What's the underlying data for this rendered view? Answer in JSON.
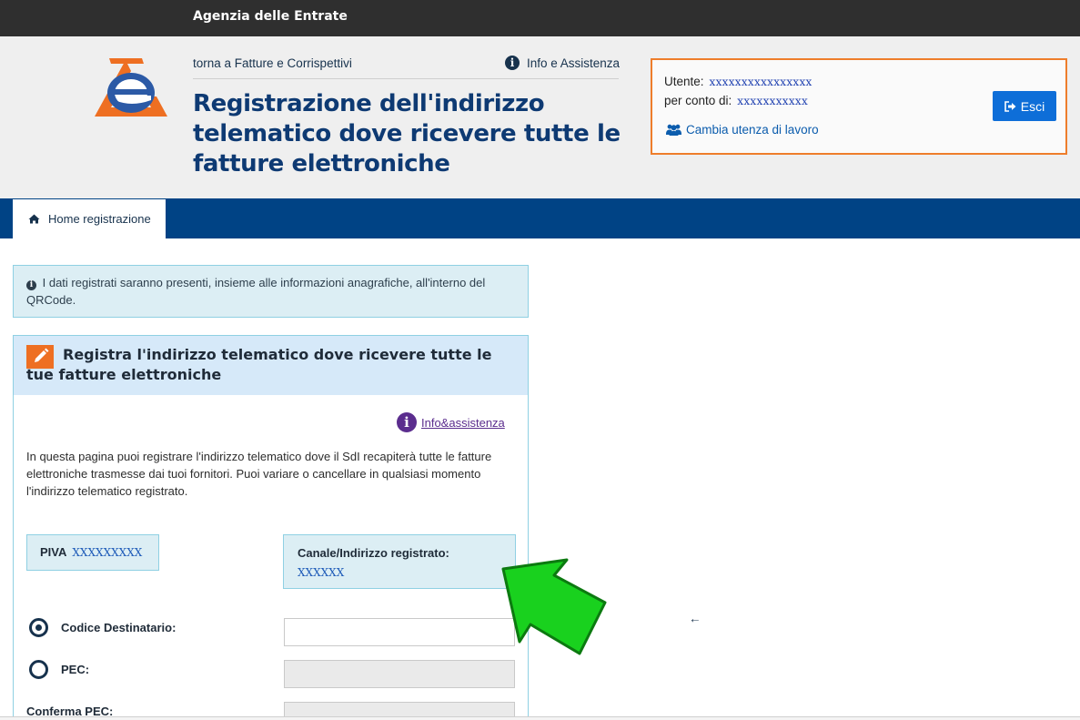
{
  "topbar": {
    "brand": "Agenzia delle Entrate"
  },
  "header": {
    "back_link": "torna a Fatture e Corrispettivi",
    "info_link": "Info e Assistenza",
    "title": "Registrazione dell'indirizzo telematico dove ricevere tutte le fatture elettroniche"
  },
  "user": {
    "user_label": "Utente:",
    "user_value": "xxxxxxxxxxxxxxxx",
    "behalf_label": "per conto di:",
    "behalf_value": "xxxxxxxxxxx",
    "switch_label": "Cambia utenza di lavoro",
    "logout_label": "Esci"
  },
  "nav": {
    "home_tab": "Home registrazione"
  },
  "alert": {
    "text": "I dati registrati saranno presenti, insieme alle informazioni anagrafiche, all'interno del QRCode."
  },
  "panel": {
    "title": "Registra l'indirizzo telematico dove ricevere tutte le tue fatture elettroniche",
    "info_link": "Info&assistenza",
    "description": "In questa pagina puoi registrare l'indirizzo telematico dove il SdI recapiterà tutte le fatture elettroniche trasmesse dai tuoi fornitori. Puoi variare o cancellare in qualsiasi momento l'indirizzo telematico registrato.",
    "piva_label": "PIVA",
    "piva_value": "XXXXXXXXX",
    "canale_label": "Canale/Indirizzo registrato:",
    "canale_value": "XXXXXX",
    "fields": {
      "codice_label": "Codice Destinatario:",
      "codice_value": "",
      "pec_label": "PEC:",
      "pec_value": "",
      "conferma_label": "Conferma PEC:",
      "conferma_value": ""
    },
    "selected_option": "Codice Destinatario"
  },
  "colors": {
    "topbar": "#2f2f2f",
    "navbar": "#004385",
    "title": "#0e3a73",
    "accent_orange": "#ee7d2b",
    "button_blue": "#0e6ed8",
    "arrow_green": "#19d11e"
  }
}
